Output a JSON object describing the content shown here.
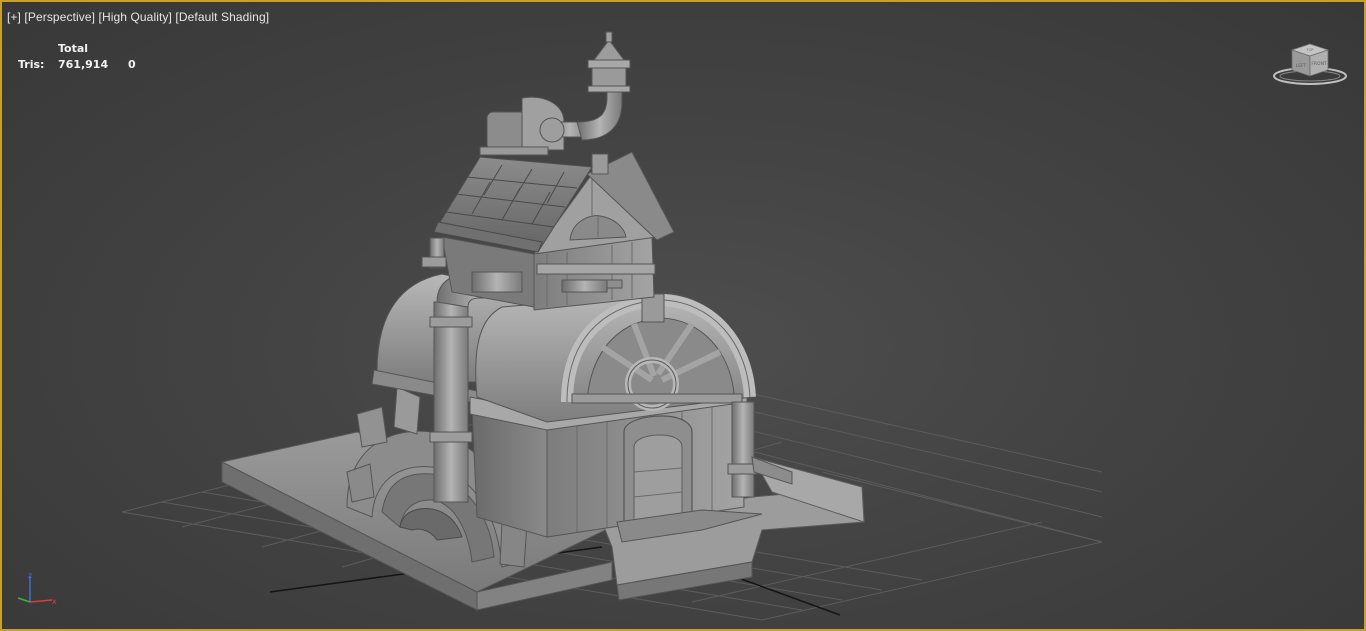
{
  "viewport": {
    "label_plus": "[+]",
    "label_view": "[Perspective]",
    "label_quality": "[High Quality]",
    "label_shading": "[Default Shading]",
    "border_color": "#c8a02e"
  },
  "stats": {
    "header": "Total",
    "tris_label": "Tris:",
    "tris_total": "761,914",
    "tris_selected": "0"
  },
  "viewcube": {
    "icon": "viewcube-icon",
    "faces": [
      "LEFT",
      "FRONT",
      "TOP"
    ]
  },
  "axis_tripod": {
    "icon": "axis-tripod-icon",
    "z_label": "z",
    "x_label": "x",
    "colors": {
      "x": "#d04040",
      "y": "#40b040",
      "z": "#4070d0"
    }
  },
  "scene": {
    "object": "steam-house-model",
    "grid": true
  }
}
